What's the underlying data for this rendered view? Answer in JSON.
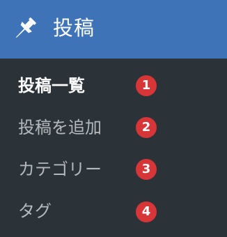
{
  "header": {
    "title": "投稿",
    "icon": "pushpin-icon"
  },
  "submenu": {
    "items": [
      {
        "label": "投稿一覧",
        "badge": "1",
        "active": true
      },
      {
        "label": "投稿を追加",
        "badge": "2",
        "active": false
      },
      {
        "label": "カテゴリー",
        "badge": "3",
        "active": false
      },
      {
        "label": "タグ",
        "badge": "4",
        "active": false
      }
    ]
  },
  "colors": {
    "header_bg": "#3e73b8",
    "menu_bg": "#2c3338",
    "badge_bg": "#d63638",
    "text_active": "#ffffff",
    "text_inactive": "#b4b9be"
  }
}
